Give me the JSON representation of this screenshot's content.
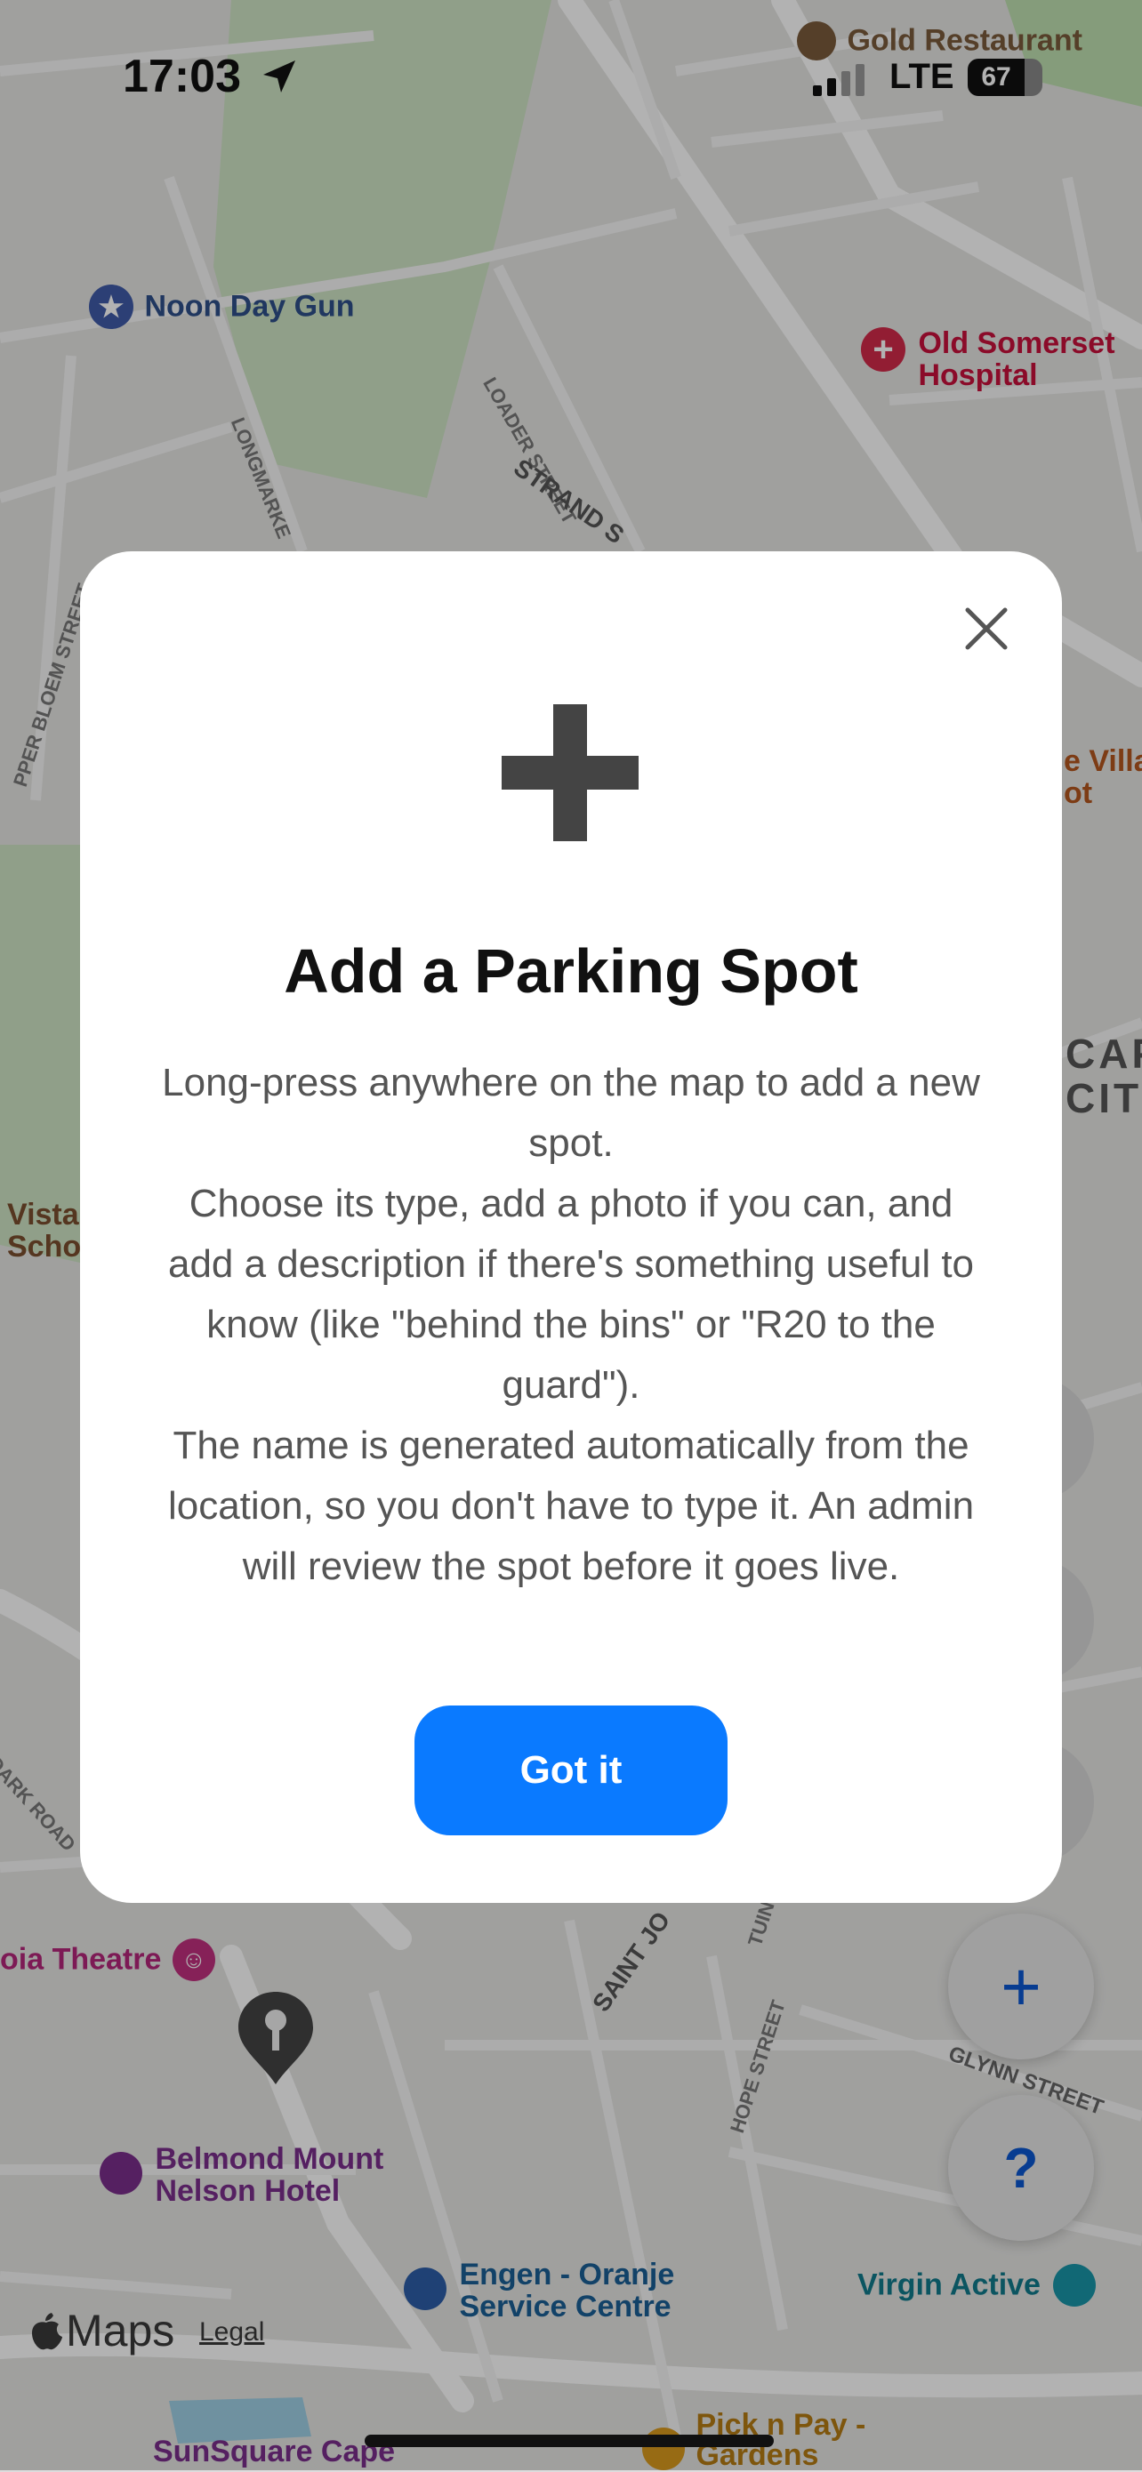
{
  "status_bar": {
    "time": "17:03",
    "network": "LTE",
    "battery": "67"
  },
  "map_labels": {
    "gold_restaurant": "Gold Restaurant",
    "noon_day_gun": "Noon Day Gun",
    "old_somerset_1": "Old Somerset",
    "old_somerset_2": "Hospital",
    "loader_street": "LOADER STREET",
    "strand_street": "STRAND S",
    "longmarket": "LONGMARKE",
    "upper_bloem": "PPER BLOEM STREET",
    "vista_1": "Vista",
    "vista_2": "Scho",
    "villa_1": "e Villa",
    "villa_2": "ot",
    "cape_1": "CAP",
    "cape_2": "CITY",
    "theatre": "oia Theatre",
    "saint_jo": "SAINT JO",
    "hope_street": "HOPE STREET",
    "tuin": "TUIN",
    "glynn_street": "GLYNN STREET",
    "dark_road": "DARK ROAD",
    "belmond_1": "Belmond Mount",
    "belmond_2": "Nelson Hotel",
    "engen_1": "Engen - Oranje",
    "engen_2": "Service Centre",
    "virgin_active": "Virgin Active",
    "sunsquare": "SunSquare Cape",
    "pick_n_pay_1": "Pick n Pay -",
    "pick_n_pay_2": "Gardens",
    "maps_brand": "Maps",
    "legal": "Legal"
  },
  "controls": {
    "add_symbol": "+",
    "help_symbol": "?"
  },
  "modal": {
    "title": "Add a Parking Spot",
    "paragraph_1": "Long-press anywhere on the map to add a new spot.",
    "paragraph_2": "Choose its type, add a photo if you can, and add a description if there's something useful to know (like \"behind the bins\" or \"R20 to the guard\").",
    "paragraph_3": "The name is generated automatically from the location, so you don't have to type it. An admin will review the spot before it goes live.",
    "button_label": "Got it"
  },
  "colors": {
    "accent": "#0a7aff",
    "map_control_blue": "#0b57d0",
    "poi_blue": "#1a5f96",
    "poi_red": "#c8103c",
    "poi_purple": "#7a2e8c",
    "poi_teal": "#117a8b"
  },
  "icons": [
    "location-arrow-icon",
    "signal-icon",
    "battery-icon",
    "close-icon",
    "plus-icon",
    "help-icon",
    "star-pin-icon",
    "hospital-pin-icon",
    "school-pin-icon",
    "theatre-pin-icon",
    "hotel-pin-icon",
    "fuel-pin-icon",
    "gym-pin-icon",
    "parking-pin-icon"
  ]
}
